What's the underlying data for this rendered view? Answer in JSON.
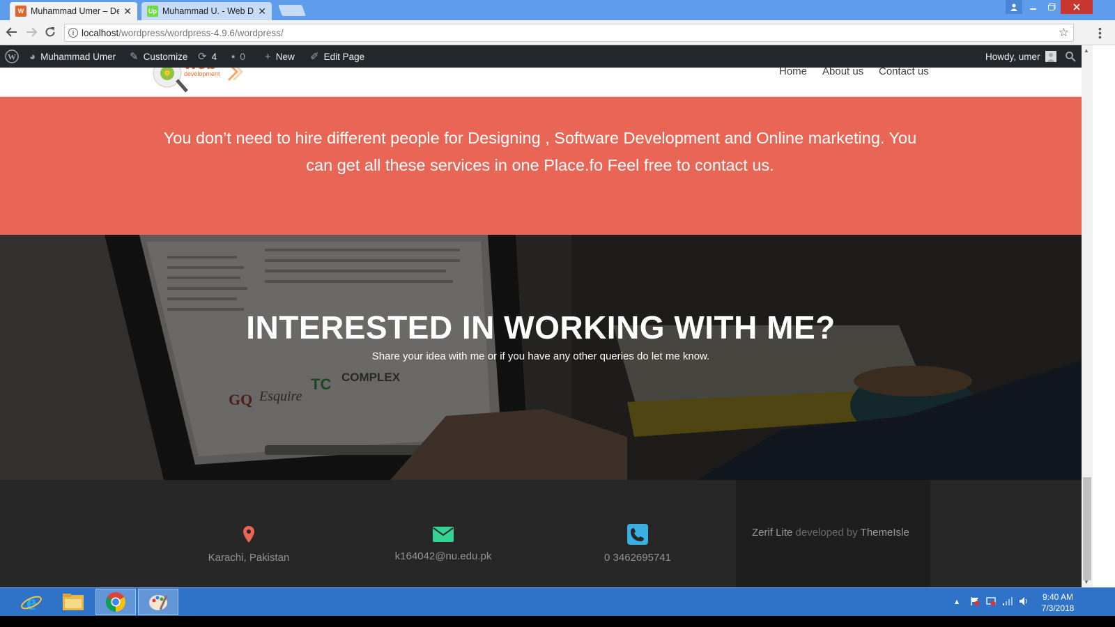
{
  "browser": {
    "tabs": [
      {
        "title": "Muhammad Umer – Deve",
        "favicon": "wordpress-favicon",
        "active": true
      },
      {
        "title": "Muhammad U. - Web De",
        "favicon": "upwork-favicon",
        "favicon_text": "Up",
        "active": false
      }
    ],
    "url_host": "localhost",
    "url_path": "/wordpress/wordpress-4.9.6/wordpress/"
  },
  "admin_bar": {
    "site_name": "Muhammad Umer",
    "customize": "Customize",
    "updates_count": "4",
    "comments_count": "0",
    "new_label": "New",
    "edit_page": "Edit Page",
    "howdy": "Howdy, umer"
  },
  "site": {
    "logo_text": "web",
    "logo_subtext": "development",
    "nav": [
      "Home",
      "About us",
      "Contact us"
    ],
    "banner_text": "You don’t need to hire different people for Designing , Software Development and Online marketing. You can get all these services in one Place.fo Feel free to contact us.",
    "cta_title": "INTERESTED IN WORKING WITH ME?",
    "cta_subtitle": "Share your idea with me or if you have any other queries do let me know.",
    "photo_text": [
      "GQ",
      "Esquire",
      "TC",
      "COMPLEX"
    ]
  },
  "footer": {
    "location": "Karachi, Pakistan",
    "email": "k164042@nu.edu.pk",
    "phone": "0 3462695741",
    "credit_theme": "Zerif Lite",
    "credit_mid": " developed by ",
    "credit_author": "ThemeIsle"
  },
  "taskbar": {
    "time": "9:40 AM",
    "date": "7/3/2018"
  },
  "colors": {
    "banner": "#e96656",
    "admin_bar": "#23282d",
    "footer": "#272727",
    "location_icon": "#e96656",
    "email_icon": "#34d293",
    "phone_icon": "#3ab0e2",
    "taskbar": "#2f73c8"
  }
}
